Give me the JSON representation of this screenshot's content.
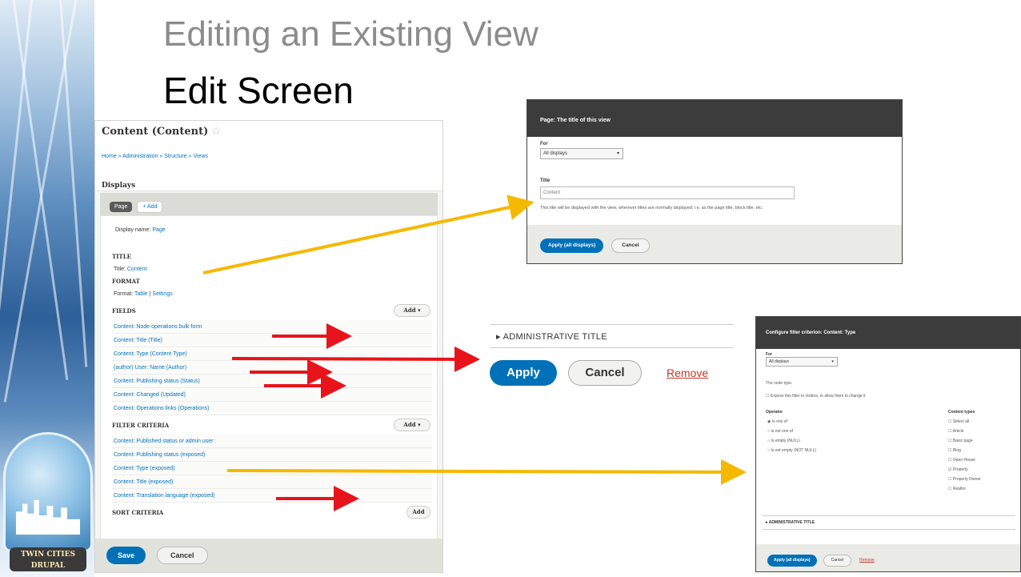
{
  "slide": {
    "title": "Editing an Existing View",
    "subtitle": "Edit Screen",
    "seal_lines": [
      "TWIN CITIES",
      "DRUPAL"
    ]
  },
  "panel": {
    "title": "Content (Content)",
    "star": "☆",
    "breadcrumb": "Home » Administration » Structure » Views",
    "displays_label": "Displays",
    "tab_page": "Page",
    "tab_add": "+ Add",
    "display_name_label": "Display name:",
    "display_name_value": "Page",
    "sections": {
      "title": {
        "heading": "TITLE",
        "label": "Title:",
        "value": "Content"
      },
      "format": {
        "heading": "FORMAT",
        "label": "Format:",
        "value": "Table",
        "sep": "|",
        "settings": "Settings"
      },
      "fields": {
        "heading": "FIELDS",
        "add_label": "Add",
        "items": [
          "Content: Node operations bulk form",
          "Content: Title (Title)",
          "Content: Type (Content Type)",
          "(author) User: Name (Author)",
          "Content: Publishing status (Status)",
          "Content: Changed (Updated)",
          "Content: Operations links (Operations)"
        ]
      },
      "filters": {
        "heading": "FILTER CRITERIA",
        "add_label": "Add",
        "items": [
          "Content: Published status or admin user",
          "Content: Publishing status (exposed)",
          "Content: Type (exposed)",
          "Content: Title (exposed)",
          "Content: Translation language (exposed)"
        ]
      },
      "sort": {
        "heading": "SORT CRITERIA",
        "add_label": "Add"
      }
    },
    "save_label": "Save",
    "cancel_label": "Cancel"
  },
  "dialog_title": {
    "header": "Page: The title of this view",
    "for_label": "For",
    "for_value": "All displays",
    "title_label": "Title",
    "title_value": "Content",
    "description": "This title will be displayed with the view, wherever titles are normally displayed; i.e, as the page title, block title, etc.",
    "apply_label": "Apply (all displays)",
    "cancel_label": "Cancel"
  },
  "zoom": {
    "admin_title": "▸ ADMINISTRATIVE TITLE",
    "apply_label": "Apply",
    "cancel_label": "Cancel",
    "remove_label": "Remove"
  },
  "dialog_filter": {
    "header": "Configure filter criterion: Content: Type",
    "for_label": "For",
    "for_value": "All displays",
    "hint": "The node type.",
    "expose_label": "Expose this filter to visitors, to allow them to change it",
    "operator_label": "Operator",
    "operators": [
      "Is one of",
      "Is not one of",
      "Is empty (NULL)",
      "Is not empty (NOT NULL)"
    ],
    "types_label": "Content types",
    "types": [
      "Select all",
      "Article",
      "Basic page",
      "Blog",
      "Open House",
      "Property",
      "Property Owner",
      "Realtor"
    ],
    "admin_title": "▸ ADMINISTRATIVE TITLE",
    "apply_label": "Apply (all displays)",
    "cancel_label": "Cancel",
    "remove_label": "Remove"
  },
  "colors": {
    "accent": "#0071b8",
    "arrow_yellow": "#f5b800",
    "arrow_red": "#e8141b",
    "remove": "#c0392b"
  }
}
